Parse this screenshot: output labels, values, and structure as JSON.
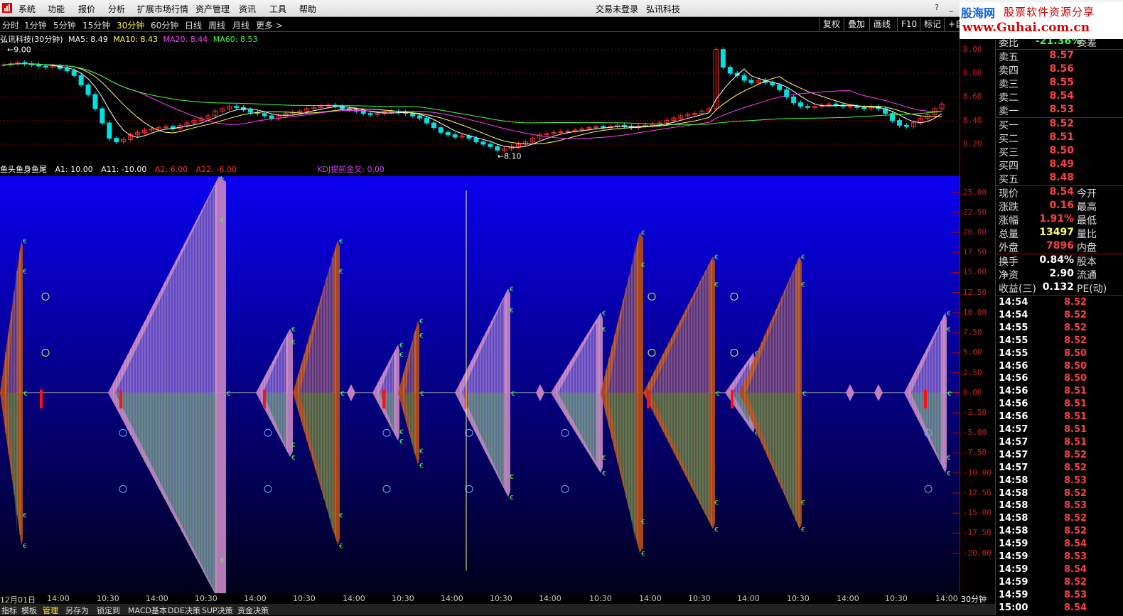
{
  "menu": {
    "items": [
      "系统",
      "功能",
      "报价",
      "分析",
      "扩展市场行情",
      "资产管理",
      "资讯",
      "工具",
      "帮助"
    ],
    "login_status": "交易未登录",
    "stock_title": "弘讯科技"
  },
  "ad": {
    "brand": "股海网",
    "slogan": "股票软件资源分享",
    "url": "www.Guhai.com.cn"
  },
  "periods": {
    "items": [
      "分时",
      "1分钟",
      "5分钟",
      "15分钟",
      "30分钟",
      "60分钟",
      "日线",
      "周线",
      "月线",
      "更多 >"
    ],
    "active_index": 4
  },
  "toolbar": {
    "buttons": [
      "复权",
      "叠加",
      "画线",
      "F10",
      "标记",
      "+自"
    ]
  },
  "price_chart": {
    "title": "弘讯科技(30分钟)",
    "ma": [
      {
        "label": "MA5: 8.49",
        "color": "#ffffff"
      },
      {
        "label": "MA10: 8.43",
        "color": "#ffff60"
      },
      {
        "label": "MA20: 8.44",
        "color": "#ff40ff"
      },
      {
        "label": "MA60: 8.53",
        "color": "#40ff40"
      }
    ],
    "y_ticks": [
      "9.00",
      "8.80",
      "8.60",
      "8.40",
      "8.20"
    ],
    "y_range": [
      8.05,
      9.07
    ],
    "annotations": {
      "high": "9.00",
      "low": "8.10"
    },
    "close": [
      8.87,
      8.88,
      8.89,
      8.88,
      8.87,
      8.86,
      8.85,
      8.86,
      8.84,
      8.82,
      8.78,
      8.7,
      8.62,
      8.5,
      8.38,
      8.25,
      8.22,
      8.24,
      8.28,
      8.3,
      8.32,
      8.33,
      8.34,
      8.35,
      8.33,
      8.36,
      8.38,
      8.4,
      8.42,
      8.44,
      8.48,
      8.5,
      8.52,
      8.51,
      8.49,
      8.47,
      8.46,
      8.44,
      8.42,
      8.44,
      8.46,
      8.47,
      8.48,
      8.5,
      8.51,
      8.52,
      8.53,
      8.52,
      8.5,
      8.49,
      8.48,
      8.46,
      8.45,
      8.46,
      8.47,
      8.48,
      8.47,
      8.46,
      8.44,
      8.42,
      8.38,
      8.34,
      8.3,
      8.28,
      8.26,
      8.27,
      8.25,
      8.22,
      8.2,
      8.18,
      8.15,
      8.16,
      8.18,
      8.2,
      8.22,
      8.25,
      8.28,
      8.29,
      8.3,
      8.31,
      8.31,
      8.32,
      8.33,
      8.34,
      8.35,
      8.34,
      8.35,
      8.36,
      8.35,
      8.34,
      8.35,
      8.36,
      8.37,
      8.38,
      8.4,
      8.42,
      8.44,
      8.45,
      8.46,
      8.48,
      8.5,
      9.0,
      8.85,
      8.8,
      8.78,
      8.74,
      8.72,
      8.74,
      8.72,
      8.7,
      8.66,
      8.6,
      8.55,
      8.52,
      8.51,
      8.52,
      8.53,
      8.54,
      8.53,
      8.52,
      8.52,
      8.51,
      8.5,
      8.52,
      8.5,
      8.46,
      8.4,
      8.36,
      8.35,
      8.38,
      8.42,
      8.45,
      8.5,
      8.54
    ],
    "ma5_color": "#ffffff",
    "ma10_color": "#ffff60",
    "ma20_color": "#ff40ff",
    "ma60_color": "#40ff40"
  },
  "indicator": {
    "title": "鱼头鱼身鱼尾",
    "labels": [
      {
        "text": "A1: 10.00",
        "color": "#ffffff"
      },
      {
        "text": "A11: -10.00",
        "color": "#ffffff"
      },
      {
        "text": "A2: 6.00",
        "color": "#ff3030"
      },
      {
        "text": "A22: -6.00",
        "color": "#ff3030"
      },
      {
        "text": "KDJ提前金叉: 0.00",
        "color": "#d040ff"
      }
    ],
    "y_ticks": [
      "25.00",
      "22.50",
      "20.00",
      "17.50",
      "15.00",
      "12.50",
      "10.00",
      "7.50",
      "5.00",
      "2.50",
      "0.00",
      "-2.50",
      "-5.00",
      "-7.50",
      "-10.00",
      "-12.50",
      "-15.00",
      "-17.50",
      "-20.00"
    ],
    "y_range": [
      -25,
      27
    ],
    "fish": [
      {
        "start": 0,
        "peak": 30,
        "end": 32,
        "pos": 19,
        "neg": -19,
        "color": "#b04a1a"
      },
      {
        "start": 152,
        "peak": 308,
        "end": 318,
        "pos": 27,
        "neg": -26,
        "color": "#c080c0"
      },
      {
        "start": 360,
        "peak": 408,
        "end": 412,
        "pos": 8,
        "neg": -8,
        "color": "#c080c0"
      },
      {
        "start": 412,
        "peak": 475,
        "end": 478,
        "pos": 19,
        "neg": -19,
        "color": "#b04a1a"
      },
      {
        "start": 524,
        "peak": 560,
        "end": 562,
        "pos": 6,
        "neg": -6,
        "color": "#c080c0"
      },
      {
        "start": 560,
        "peak": 588,
        "end": 590,
        "pos": 9,
        "neg": -9,
        "color": "#b04a1a"
      },
      {
        "start": 640,
        "peak": 715,
        "end": 718,
        "pos": 13,
        "neg": -13,
        "color": "#c080c0"
      },
      {
        "start": 775,
        "peak": 845,
        "end": 848,
        "pos": 10,
        "neg": -10,
        "color": "#c080c0"
      },
      {
        "start": 845,
        "peak": 900,
        "end": 905,
        "pos": 20,
        "neg": -20,
        "color": "#b04a1a"
      },
      {
        "start": 905,
        "peak": 1003,
        "end": 1006,
        "pos": 17,
        "neg": -17,
        "color": "#b04a1a"
      },
      {
        "start": 1020,
        "peak": 1060,
        "end": 1062,
        "pos": 5,
        "neg": -5,
        "color": "#c080c0"
      },
      {
        "start": 1040,
        "peak": 1125,
        "end": 1128,
        "pos": 17,
        "neg": -17,
        "color": "#b04a1a"
      },
      {
        "start": 1272,
        "peak": 1330,
        "end": 1332,
        "pos": 10,
        "neg": -10,
        "color": "#c080c0"
      }
    ],
    "circles": [
      {
        "x": 64,
        "v": 12
      },
      {
        "x": 64,
        "v": 5
      },
      {
        "x": 173,
        "v": -5
      },
      {
        "x": 173,
        "v": -12
      },
      {
        "x": 377,
        "v": -5
      },
      {
        "x": 377,
        "v": -12
      },
      {
        "x": 544,
        "v": -5
      },
      {
        "x": 544,
        "v": -12
      },
      {
        "x": 660,
        "v": -5
      },
      {
        "x": 660,
        "v": -12
      },
      {
        "x": 795,
        "v": -5
      },
      {
        "x": 795,
        "v": -12
      },
      {
        "x": 917,
        "v": 12
      },
      {
        "x": 917,
        "v": 5
      },
      {
        "x": 1033,
        "v": 12
      },
      {
        "x": 1033,
        "v": 5
      },
      {
        "x": 1306,
        "v": -5
      },
      {
        "x": 1306,
        "v": -12
      }
    ],
    "small_diamonds": [
      494,
      760,
      1196,
      1236
    ]
  },
  "time_axis": {
    "labels": [
      "12月01日",
      "14:00",
      "10:30",
      "14:00",
      "10:30",
      "14:00",
      "10:30",
      "14:00",
      "10:30",
      "14:00",
      "10:30",
      "14:00",
      "10:30",
      "14:00",
      "10:30",
      "14:00",
      "10:30",
      "14:00",
      "10:30",
      "14:00"
    ],
    "period": "30分钟"
  },
  "bottom_tabs": {
    "items": [
      "指标",
      "模板",
      "管理",
      "另存为",
      "锁定到",
      "MACD基本",
      "DDE决策",
      "SUP决策",
      "资金决策"
    ],
    "active_index": 2
  },
  "quote": {
    "weibi": {
      "label": "委比",
      "value": "-21.36%",
      "right": "委差"
    },
    "sell": [
      {
        "label": "卖五",
        "price": "8.57"
      },
      {
        "label": "卖四",
        "price": "8.56"
      },
      {
        "label": "卖三",
        "price": "8.55"
      },
      {
        "label": "卖二",
        "price": "8.54"
      },
      {
        "label": "卖一",
        "price": "8.53"
      }
    ],
    "buy": [
      {
        "label": "买一",
        "price": "8.52"
      },
      {
        "label": "买二",
        "price": "8.51"
      },
      {
        "label": "买三",
        "price": "8.50"
      },
      {
        "label": "买四",
        "price": "8.49"
      },
      {
        "label": "买五",
        "price": "8.48"
      }
    ],
    "stats1": [
      {
        "label": "现价",
        "value": "8.54",
        "right": "今开",
        "color": "red"
      },
      {
        "label": "涨跌",
        "value": "0.16",
        "right": "最高",
        "color": "red"
      },
      {
        "label": "涨幅",
        "value": "1.91%",
        "right": "最低",
        "color": "red"
      },
      {
        "label": "总量",
        "value": "13497",
        "right": "量比",
        "color": "ylw"
      },
      {
        "label": "外盘",
        "value": "7896",
        "right": "内盘",
        "color": "red"
      }
    ],
    "stats2": [
      {
        "label": "换手",
        "value": "0.84%",
        "right": "股本",
        "color": "wht"
      },
      {
        "label": "净资",
        "value": "2.90",
        "right": "流通",
        "color": "wht"
      },
      {
        "label": "收益(三)",
        "value": "0.132",
        "right": "PE(动)",
        "color": "wht"
      }
    ],
    "ticks": [
      {
        "time": "14:54",
        "price": "8.52"
      },
      {
        "time": "14:54",
        "price": "8.52"
      },
      {
        "time": "14:55",
        "price": "8.52"
      },
      {
        "time": "14:55",
        "price": "8.52"
      },
      {
        "time": "14:55",
        "price": "8.50"
      },
      {
        "time": "14:56",
        "price": "8.50"
      },
      {
        "time": "14:56",
        "price": "8.50"
      },
      {
        "time": "14:56",
        "price": "8.51"
      },
      {
        "time": "14:56",
        "price": "8.51"
      },
      {
        "time": "14:56",
        "price": "8.51"
      },
      {
        "time": "14:57",
        "price": "8.51"
      },
      {
        "time": "14:57",
        "price": "8.51"
      },
      {
        "time": "14:57",
        "price": "8.52"
      },
      {
        "time": "14:57",
        "price": "8.52"
      },
      {
        "time": "14:58",
        "price": "8.53"
      },
      {
        "time": "14:58",
        "price": "8.52"
      },
      {
        "time": "14:58",
        "price": "8.53"
      },
      {
        "time": "14:58",
        "price": "8.52"
      },
      {
        "time": "14:58",
        "price": "8.52"
      },
      {
        "time": "14:59",
        "price": "8.54"
      },
      {
        "time": "14:59",
        "price": "8.53"
      },
      {
        "time": "14:59",
        "price": "8.54"
      },
      {
        "time": "14:59",
        "price": "8.52"
      },
      {
        "time": "14:59",
        "price": "8.53"
      },
      {
        "time": "15:00",
        "price": "8.54"
      }
    ]
  }
}
